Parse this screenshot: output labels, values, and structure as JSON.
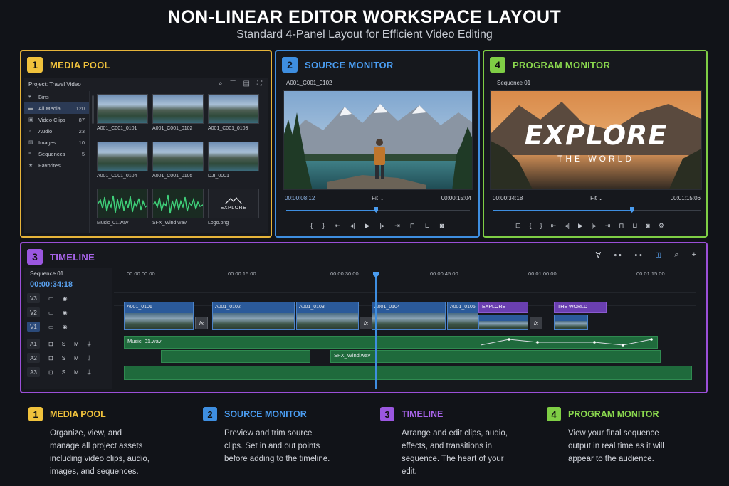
{
  "header": {
    "title": "NON-LINEAR EDITOR WORKSPACE LAYOUT",
    "subtitle": "Standard 4-Panel Layout for Efficient Video Editing"
  },
  "colors": {
    "media": "#f0c23c",
    "source": "#3e8ee0",
    "timeline": "#9b57e0",
    "program": "#7fce45"
  },
  "media_pool": {
    "number": "1",
    "title": "MEDIA POOL",
    "project": "Project: Travel Video",
    "tool_icons": [
      "search-icon",
      "list-view-icon",
      "grid-view-icon",
      "fullscreen-icon"
    ],
    "bins": [
      {
        "label": "Bins",
        "count": "",
        "icon": "chevron-down-icon"
      },
      {
        "label": "All Media",
        "count": "120",
        "icon": "folder-icon",
        "selected": true
      },
      {
        "label": "Video Clips",
        "count": "87",
        "icon": "film-icon"
      },
      {
        "label": "Audio",
        "count": "23",
        "icon": "music-icon"
      },
      {
        "label": "Images",
        "count": "10",
        "icon": "image-icon"
      },
      {
        "label": "Sequences",
        "count": "5",
        "icon": "sequence-icon"
      },
      {
        "label": "Favorites",
        "count": "",
        "icon": "star-icon"
      }
    ],
    "items": [
      "A001_C001_0101",
      "A001_C001_0102",
      "A001_C001_0103",
      "A001_C001_0104",
      "A001_C001_0105",
      "DJI_0001",
      "Music_01.wav",
      "SFX_Wind.wav",
      "Logo.png"
    ],
    "logo_text": "EXPLORE"
  },
  "source_monitor": {
    "number": "2",
    "title": "SOURCE MONITOR",
    "clip": "A001_C001_0102",
    "timecode": "00:00:08:12",
    "zoom": "Fit",
    "duration": "00:00:15:04",
    "progress": 0.49
  },
  "program_monitor": {
    "number": "4",
    "title": "PROGRAM MONITOR",
    "sequence": "Sequence 01",
    "timecode": "00:00:34:18",
    "zoom": "Fit",
    "duration": "00:01:15:06",
    "overlay_title": "EXPLORE",
    "overlay_subtitle": "THE WORLD",
    "progress": 0.67
  },
  "timeline": {
    "number": "3",
    "title": "TIMELINE",
    "sequence": "Sequence 01",
    "timecode": "00:00:34:18",
    "ruler": [
      "00:00:00:00",
      "00:00:15:00",
      "00:00:30:00",
      "00:00:45:00",
      "00:01:00:00",
      "00:01:15:00"
    ],
    "tracks": {
      "video": [
        "V3",
        "V2",
        "V1"
      ],
      "audio": [
        "A1",
        "A2",
        "A3"
      ],
      "solo": "S",
      "mute": "M"
    },
    "clips": {
      "v1": [
        "A001_0101",
        "A001_0102",
        "A001_0103",
        "A001_0104",
        "A001_0105"
      ],
      "titles": [
        "EXPLORE",
        "THE WORLD"
      ],
      "fx": "fx",
      "a1": "Music_01.wav",
      "a2": "SFX_Wind.wav"
    }
  },
  "descriptions": [
    {
      "number": "1",
      "title": "MEDIA POOL",
      "body": "Organize, view, and manage all project assets including video clips, audio, images, and sequences."
    },
    {
      "number": "2",
      "title": "SOURCE MONITOR",
      "body": "Preview and trim source clips. Set in and out points before adding to the timeline."
    },
    {
      "number": "3",
      "title": "TIMELINE",
      "body": "Arrange and edit clips, audio, effects, and transitions in sequence. The heart of your edit."
    },
    {
      "number": "4",
      "title": "PROGRAM MONITOR",
      "body": "View your final sequence output in real time as it will appear to the audience."
    }
  ]
}
